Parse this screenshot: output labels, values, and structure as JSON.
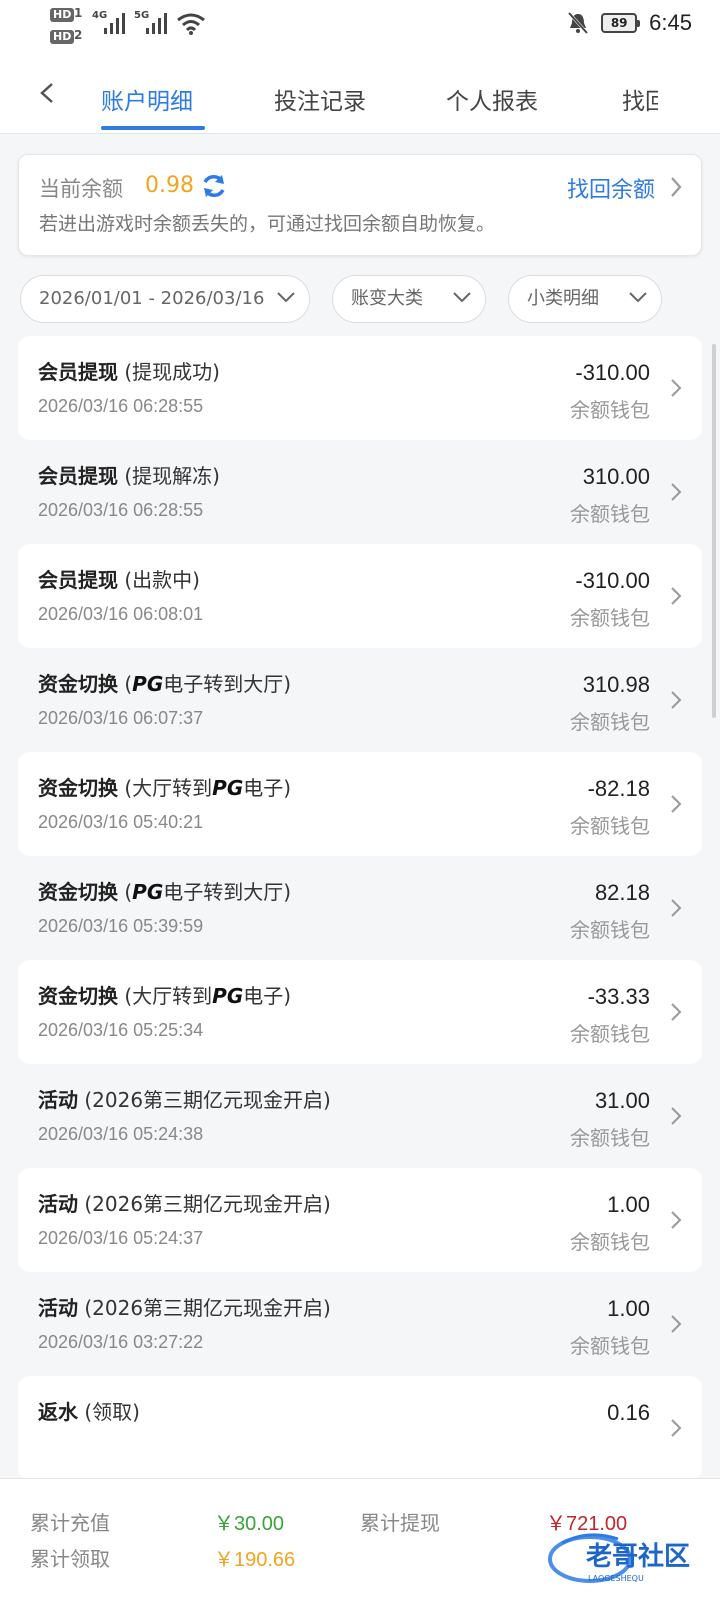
{
  "status_bar": {
    "hd1": "HD",
    "hd1_num": "1",
    "hd2": "HD",
    "hd2_num": "2",
    "net1": "4G",
    "net2": "5G",
    "battery": "89",
    "time": "6:45"
  },
  "nav": {
    "tabs": [
      {
        "label": "账户明细"
      },
      {
        "label": "投注记录"
      },
      {
        "label": "个人报表"
      },
      {
        "label": "找回"
      }
    ]
  },
  "balance": {
    "label": "当前余额",
    "value": "0.98",
    "hint": "若进出游戏时余额丢失的，可通过找回余额自助恢复。",
    "recover": "找回余额"
  },
  "filters": {
    "date_range": "2026/01/01 - 2026/03/16",
    "category": "账变大类",
    "subcategory": "小类明细"
  },
  "records": [
    {
      "type": "会员提现",
      "pre": " (提现成功)",
      "pg": "",
      "post": "",
      "time": "2026/03/16 06:28:55",
      "amount": "-310.00",
      "wallet": "余额钱包"
    },
    {
      "type": "会员提现",
      "pre": " (提现解冻)",
      "pg": "",
      "post": "",
      "time": "2026/03/16 06:28:55",
      "amount": "310.00",
      "wallet": "余额钱包"
    },
    {
      "type": "会员提现",
      "pre": " (出款中)",
      "pg": "",
      "post": "",
      "time": "2026/03/16 06:08:01",
      "amount": "-310.00",
      "wallet": "余额钱包"
    },
    {
      "type": "资金切换",
      "pre": " (",
      "pg": "PG",
      "post": "电子转到大厅)",
      "time": "2026/03/16 06:07:37",
      "amount": "310.98",
      "wallet": "余额钱包"
    },
    {
      "type": "资金切换",
      "pre": " (大厅转到",
      "pg": "PG",
      "post": "电子)",
      "time": "2026/03/16 05:40:21",
      "amount": "-82.18",
      "wallet": "余额钱包"
    },
    {
      "type": "资金切换",
      "pre": " (",
      "pg": "PG",
      "post": "电子转到大厅)",
      "time": "2026/03/16 05:39:59",
      "amount": "82.18",
      "wallet": "余额钱包"
    },
    {
      "type": "资金切换",
      "pre": " (大厅转到",
      "pg": "PG",
      "post": "电子)",
      "time": "2026/03/16 05:25:34",
      "amount": "-33.33",
      "wallet": "余额钱包"
    },
    {
      "type": "活动",
      "pre": " (2026第三期亿元现金开启)",
      "pg": "",
      "post": "",
      "time": "2026/03/16 05:24:38",
      "amount": "31.00",
      "wallet": "余额钱包"
    },
    {
      "type": "活动",
      "pre": " (2026第三期亿元现金开启)",
      "pg": "",
      "post": "",
      "time": "2026/03/16 05:24:37",
      "amount": "1.00",
      "wallet": "余额钱包"
    },
    {
      "type": "活动",
      "pre": " (2026第三期亿元现金开启)",
      "pg": "",
      "post": "",
      "time": "2026/03/16 03:27:22",
      "amount": "1.00",
      "wallet": "余额钱包"
    },
    {
      "type": "返水",
      "pre": " (领取)",
      "pg": "",
      "post": "",
      "time": "",
      "amount": "0.16",
      "wallet": ""
    }
  ],
  "footer": {
    "deposit_label": "累计充值",
    "deposit_value": "￥30.00",
    "withdraw_label": "累计提现",
    "withdraw_value": "￥721.00",
    "claim_label": "累计领取",
    "claim_value": "￥190.66",
    "watermark_text": "老哥社区",
    "watermark_sub": "LAOGESHEQU"
  },
  "colors": {
    "accent": "#2d7be5",
    "balance": "#f2a41f",
    "deposit": "#3aa33a",
    "withdraw": "#c0262d",
    "claim": "#f2a41f"
  }
}
